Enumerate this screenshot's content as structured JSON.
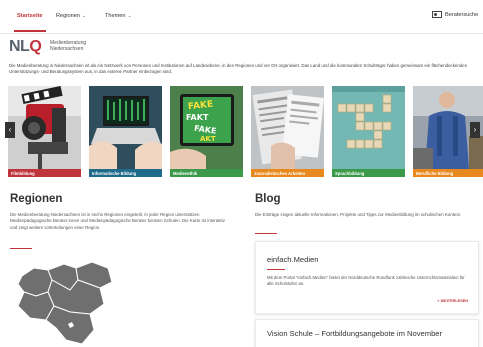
{
  "nav": {
    "start": "Startseite",
    "regionen": "Regionen",
    "themen": "Themen",
    "berater": "Beratersuche"
  },
  "logo": {
    "nlq": "NLQ",
    "sub_line1": "Medienberatung",
    "sub_line2": "Niedersachsen"
  },
  "intro": "Die Medienberatung in Niedersachsen ist als ein Netzwerk von Personen und Institutionen auf Landesebene, in den Regionen und vor Ort organisiert. Das Land und die kommunalen Schulträger haben gemeinsam ein flächendeckendes Unterstützungs- und Beratungssystem aus, in das externe Partner einbezogen sind.",
  "carousel": {
    "tiles": [
      {
        "label": "Filmbildung",
        "color": "#c0353c"
      },
      {
        "label": "Informatische Bildung",
        "color": "#1e6b8c"
      },
      {
        "label": "Medienethik",
        "color": "#3a9a4a"
      },
      {
        "label": "Journalistisches Arbeiten",
        "color": "#e8891f"
      },
      {
        "label": "Sprachbildung",
        "color": "#3a9a4a"
      },
      {
        "label": "Berufliche Bildung",
        "color": "#e8891f"
      }
    ],
    "prev_icon": "chevron-left-icon",
    "next_icon": "chevron-right-icon"
  },
  "regionen": {
    "title": "Regionen",
    "text": "Die Medienberatung Niedersachsen ist in sechs Regionen eingeteilt. In jeder Region unterstützen Medienpädagogische Berater:innen und Medienpädagogische Berater beraten Schulen. Die Karte ist interaktiv und zeigt weitere Unterteilungen einer Region."
  },
  "blog": {
    "title": "Blog",
    "text": "Die Einträge zeigen aktuelle Informationen, Projekte und Tipps zur Medienbildung im schulischen Kontext.",
    "posts": [
      {
        "title": "einfach.Medien",
        "text": "Mit dem Portal \"einfach.Medien\" bietet der Norddeutsche Rundfunk zahlreiche Unterrichtsmaterialien für alle Schulstufen an.",
        "link": "» WEITERLESEN"
      },
      {
        "title": "Vision Schule – Fortbildungsangebote im November"
      }
    ]
  },
  "colors": {
    "accent": "#c0353c",
    "map": "#6f6f6f"
  }
}
